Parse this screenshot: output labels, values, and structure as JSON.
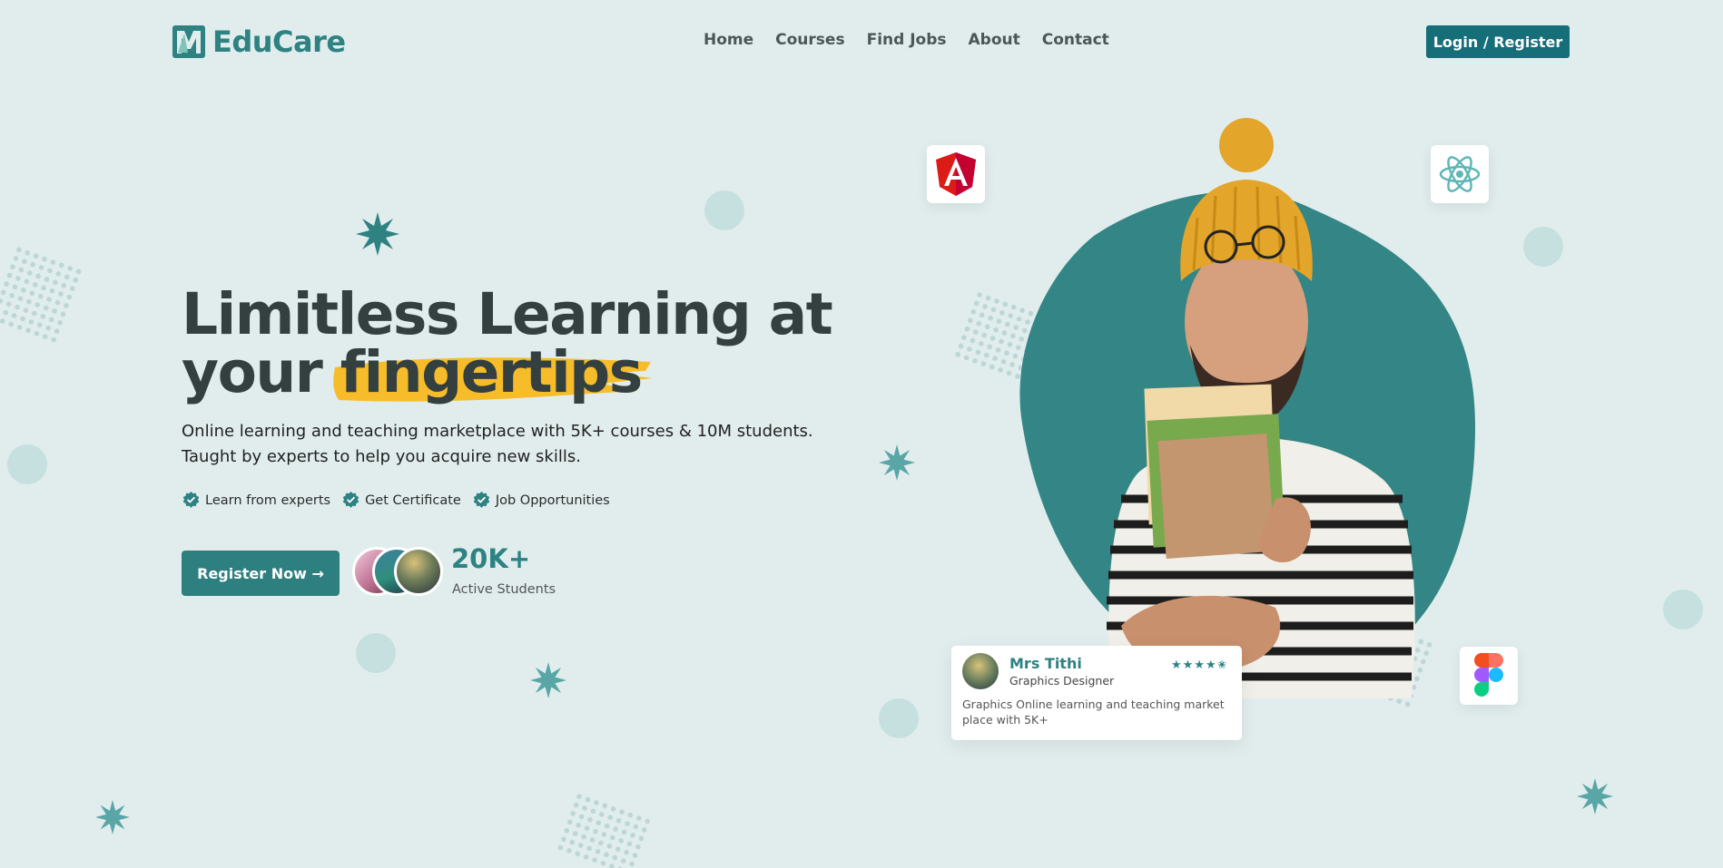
{
  "brand": {
    "name": "EduCare",
    "accent": "#2f8282",
    "button": "#156e78"
  },
  "nav": {
    "items": [
      "Home",
      "Courses",
      "Find Jobs",
      "About",
      "Contact"
    ],
    "login_label": "Login / Register"
  },
  "hero": {
    "title_line1": "Limitless Learning at",
    "title_line2_plain": "your",
    "title_line2_highlight": "fingertips",
    "subtitle_line1": "Online learning and teaching marketplace with 5K+ courses & 10M students.",
    "subtitle_line2": "Taught by experts to help you acquire new skills.",
    "features": [
      "Learn from experts",
      "Get Certificate",
      "Job Opportunities"
    ],
    "register_label": "Register Now →",
    "stat_value": "20K+",
    "stat_label": "Active Students"
  },
  "tech_icons": [
    "angular-icon",
    "react-icon",
    "figma-icon"
  ],
  "review": {
    "name": "Mrs Tithi",
    "role": "Graphics Designer",
    "stars": "★★★★✬",
    "rating": 4.5,
    "text": "Graphics Online learning and teaching market place with 5K+"
  }
}
